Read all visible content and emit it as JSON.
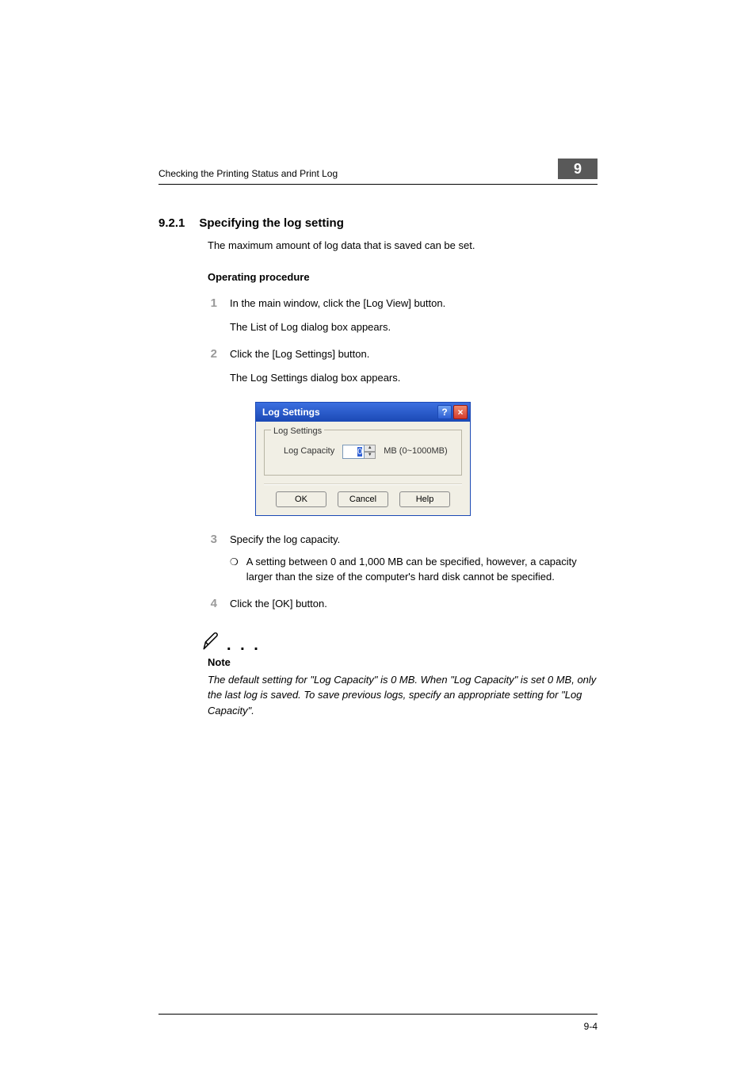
{
  "header": {
    "title": "Checking the Printing Status and Print Log",
    "chapter": "9"
  },
  "section": {
    "number": "9.2.1",
    "title": "Specifying the log setting",
    "intro": "The maximum amount of log data that is saved can be set."
  },
  "procedure": {
    "heading": "Operating procedure",
    "steps": [
      {
        "n": "1",
        "text": "In the main window, click the [Log View] button.",
        "follow": "The List of Log dialog box appears."
      },
      {
        "n": "2",
        "text": "Click the [Log Settings] button.",
        "follow": "The Log Settings dialog box appears."
      },
      {
        "n": "3",
        "text": "Specify the log capacity.",
        "bullet": "A setting between 0 and 1,000 MB can be specified, however, a capacity larger than the size of the computer's hard disk cannot be specified."
      },
      {
        "n": "4",
        "text": "Click the [OK] button."
      }
    ]
  },
  "dialog": {
    "title": "Log Settings",
    "group_legend": "Log Settings",
    "field_label": "Log Capacity",
    "value": "0",
    "unit_hint": "MB (0~1000MB)",
    "buttons": {
      "ok": "OK",
      "cancel": "Cancel",
      "help": "Help"
    },
    "titlebar_icons": {
      "help": "?",
      "close": "×"
    },
    "spin": {
      "up": "▲",
      "down": "▼"
    }
  },
  "note": {
    "label": "Note",
    "body": "The default setting for \"Log Capacity\" is 0 MB. When \"Log Capacity\" is set 0 MB, only the last log is saved. To save previous logs, specify an appropriate setting for \"Log Capacity\"."
  },
  "footer": {
    "page": "9-4"
  },
  "bullet_glyph": "❍",
  "note_dots": ". . ."
}
